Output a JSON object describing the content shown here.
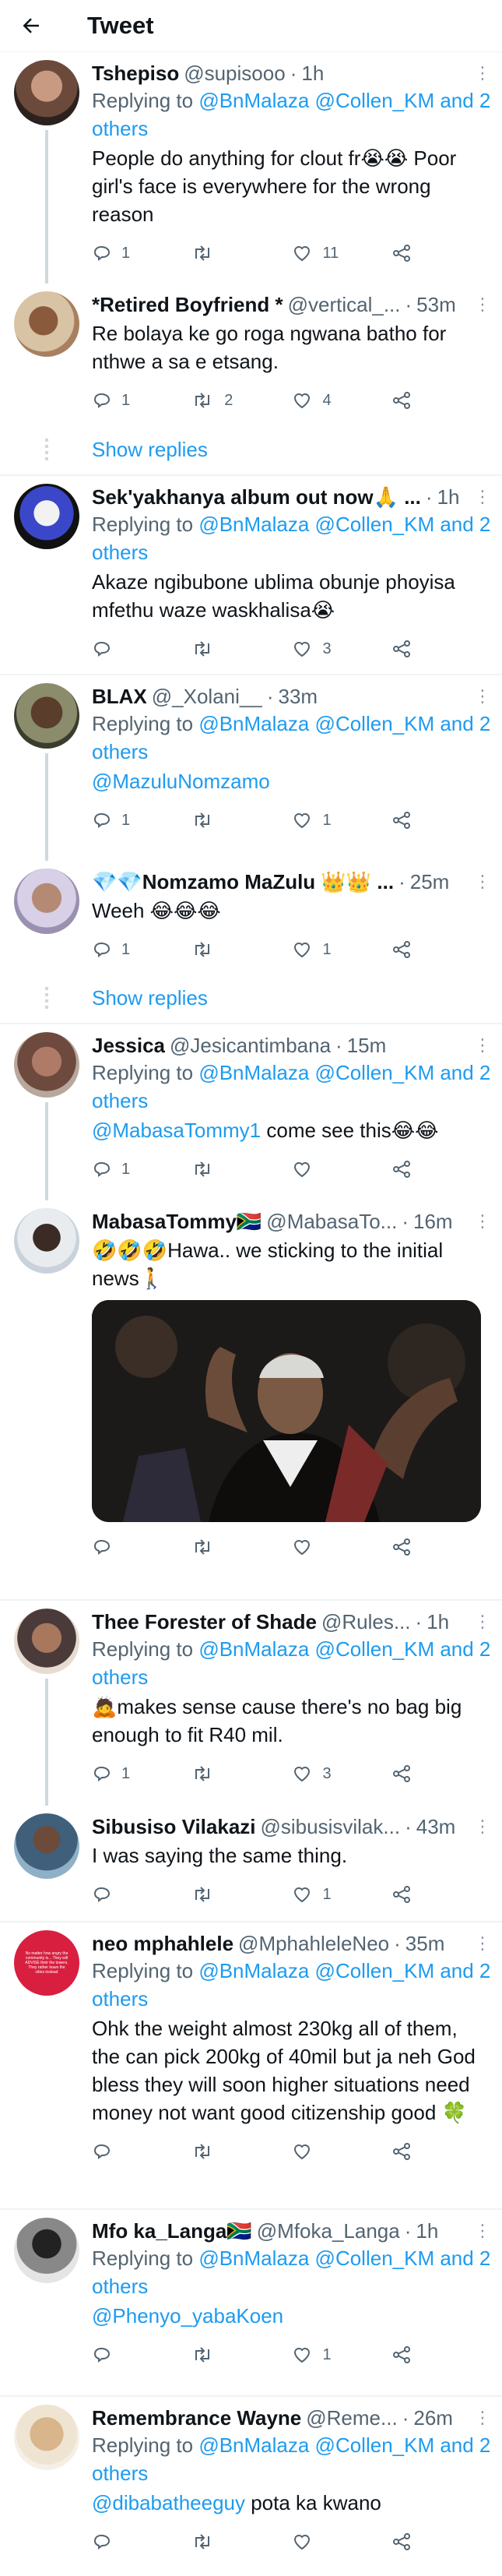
{
  "header": {
    "title": "Tweet"
  },
  "show_replies_label": "Show replies",
  "tweets": [
    {
      "name": "Tshepiso",
      "handle": "@supisooo",
      "time": "1h",
      "reply_prefix": "Replying to",
      "reply_mentions": "@BnMalaza @Collen_KM and 2 others",
      "text": "People do anything for clout fr😭😭 Poor girl's face is everywhere for the wrong reason",
      "counts": {
        "reply": "1",
        "retweet": "",
        "like": "11"
      }
    },
    {
      "name": "*Retired Boyfriend *",
      "handle": "@vertical_...",
      "time": "53m",
      "text": "Re bolaya ke go roga ngwana batho for nthwe a sa e etsang.",
      "counts": {
        "reply": "1",
        "retweet": "2",
        "like": "4"
      }
    },
    {
      "name": "Sek'yakhanya album out now🙏 ...",
      "handle": "",
      "time": "1h",
      "reply_prefix": "Replying to",
      "reply_mentions": "@BnMalaza @Collen_KM and 2 others",
      "text": "Akaze ngibubone ublima obunje phoyisa mfethu waze waskhalisa😭",
      "counts": {
        "reply": "",
        "retweet": "",
        "like": "3"
      }
    },
    {
      "name": "BLAX",
      "handle": "@_Xolani__",
      "time": "33m",
      "reply_prefix": "Replying to",
      "reply_mentions": "@BnMalaza @Collen_KM and 2 others",
      "text_mention": "@MazuluNomzamo",
      "text": "",
      "counts": {
        "reply": "1",
        "retweet": "",
        "like": "1"
      }
    },
    {
      "name": "💎💎Nomzamo MaZulu 👑👑 ...",
      "handle": "",
      "time": "25m",
      "text": "Weeh 😂😂😂",
      "counts": {
        "reply": "1",
        "retweet": "",
        "like": "1"
      }
    },
    {
      "name": "Jessica",
      "handle": "@Jesicantimbana",
      "time": "15m",
      "reply_prefix": "Replying to",
      "reply_mentions": "@BnMalaza @Collen_KM and 2 others",
      "text_mention": "@MabasaTommy1",
      "text": " come see this😂😂",
      "counts": {
        "reply": "1",
        "retweet": "",
        "like": ""
      }
    },
    {
      "name": "MabasaTommy🇿🇦",
      "handle": "@MabasaTo...",
      "time": "16m",
      "text": "🤣🤣🤣Hawa.. we sticking to the initial news🚶",
      "counts": {
        "reply": "",
        "retweet": "",
        "like": ""
      }
    },
    {
      "name": "Thee Forester of Shade",
      "handle": "@Rules...",
      "time": "1h",
      "reply_prefix": "Replying to",
      "reply_mentions": "@BnMalaza @Collen_KM and 2 others",
      "text": "🙇makes sense cause there's no bag big enough to fit R40 mil.",
      "counts": {
        "reply": "1",
        "retweet": "",
        "like": "3"
      }
    },
    {
      "name": "Sibusiso Vilakazi",
      "handle": "@sibusisvilak...",
      "time": "43m",
      "text": "I was saying the same thing.",
      "counts": {
        "reply": "",
        "retweet": "",
        "like": "1"
      }
    },
    {
      "name": "neo mphahlele",
      "handle": "@MphahleleNeo",
      "time": "35m",
      "reply_prefix": "Replying to",
      "reply_mentions": "@BnMalaza @Collen_KM and 2 others",
      "text": "Ohk the weight almost 230kg all of them, the can pick 200kg of 40mil but ja neh God bless they will soon higher situations need money not want good citizenship good 🍀",
      "avatar_text": "No matter how angry the community is... They will ADVISE their the towers. They rather leave the cities instead",
      "counts": {
        "reply": "",
        "retweet": "",
        "like": ""
      }
    },
    {
      "name": "Mfo ka_Langa🇿🇦",
      "handle": "@Mfoka_Langa",
      "time": "1h",
      "reply_prefix": "Replying to",
      "reply_mentions": "@BnMalaza @Collen_KM and 2 others",
      "text_mention": "@Phenyo_yabaKoen",
      "text": "",
      "counts": {
        "reply": "",
        "retweet": "",
        "like": "1"
      }
    },
    {
      "name": "Remembrance Wayne",
      "handle": "@Reme...",
      "time": "26m",
      "reply_prefix": "Replying to",
      "reply_mentions": "@BnMalaza @Collen_KM and 2 others",
      "text_mention": "@dibabatheeguy",
      "text": " pota ka kwano",
      "counts": {
        "reply": "",
        "retweet": "",
        "like": ""
      }
    }
  ],
  "colors": {
    "accent": "#1d9bf0",
    "secondary_text": "#536471",
    "thread_line": "#cfd9de"
  }
}
